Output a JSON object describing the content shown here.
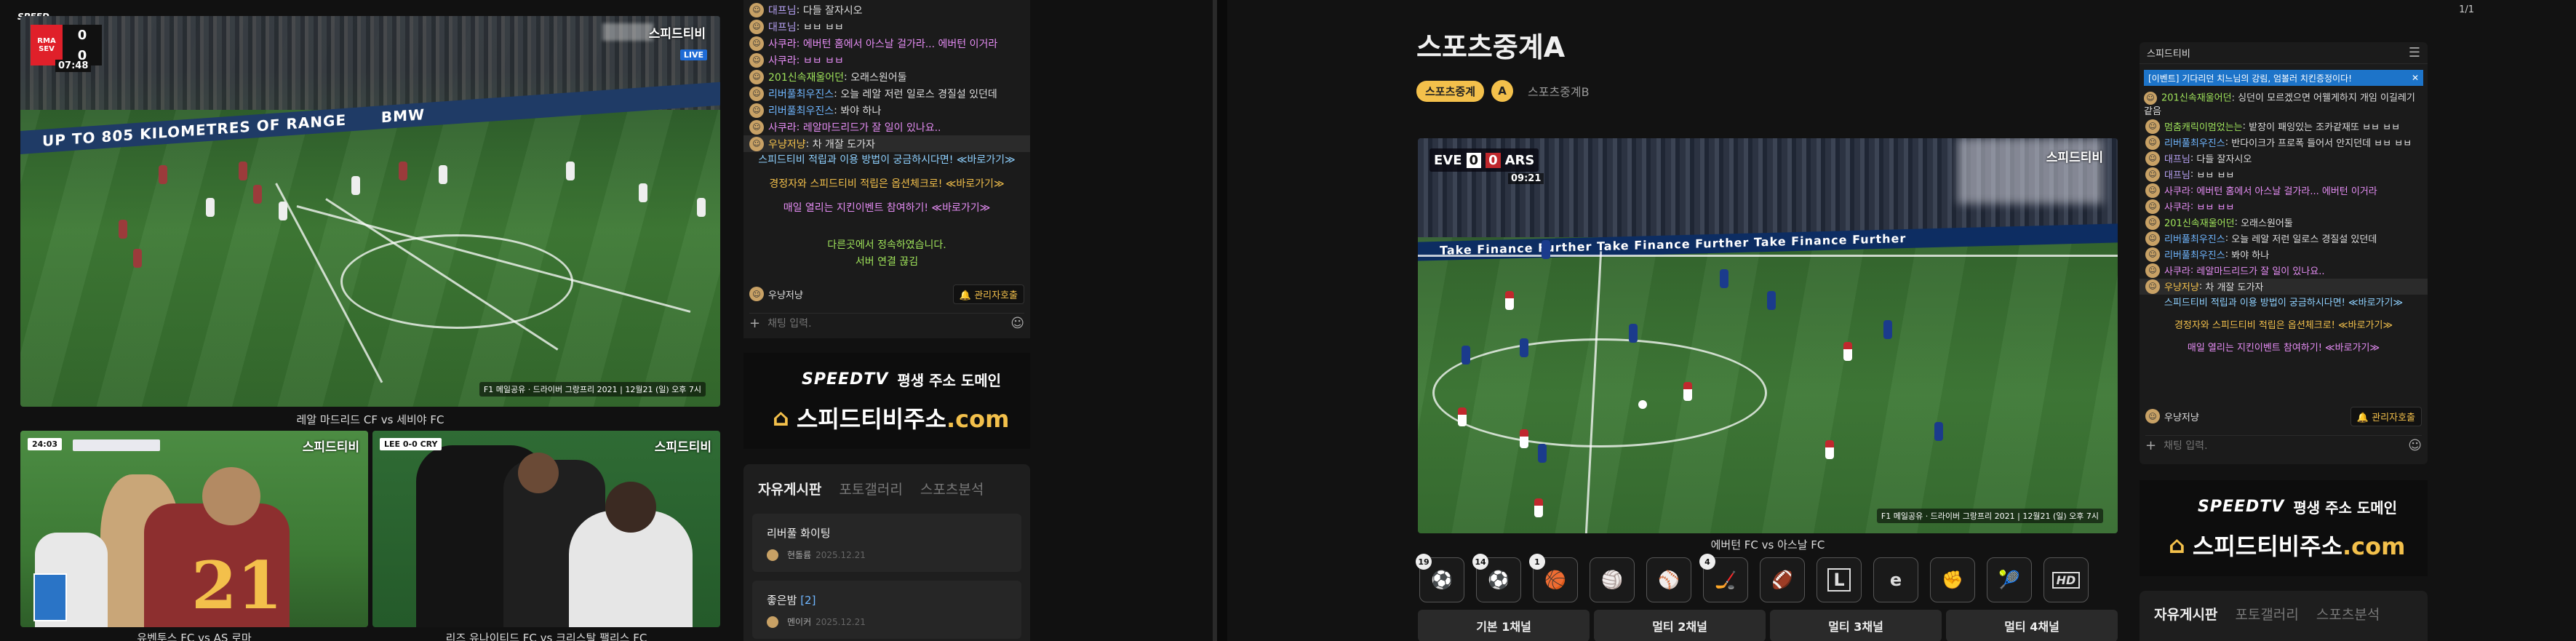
{
  "left_window": {
    "speed_label": "SPEED",
    "main_video": {
      "watermark": "스피드티비",
      "live_badge": "LIVE",
      "score": {
        "home": "0",
        "away": "0",
        "clock": "07:48",
        "home_abbr": "RMA",
        "away_abbr": "SEV"
      },
      "ad_text": "UP TO 805 KILOMETRES OF RANGE",
      "ad_brand": "BMW",
      "ticker": "F1 메일공유 · 드라이버 그랑프리 2021 | 12월21 (일) 오후 7시",
      "caption": "레알 마드리드 CF vs 세비야 FC"
    },
    "video_2": {
      "watermark": "스피드티비",
      "clock": "24:03",
      "caption": "유벤투스 FC vs AS 로마"
    },
    "video_3": {
      "watermark": "스피드티비",
      "clock": "LEE 0-0 CRY",
      "caption": "리즈 유나이티드 FC vs 크리스탈 팰리스 FC"
    },
    "chat": {
      "messages": [
        {
          "user": "대프님",
          "text": "다들 잘자시오",
          "color": "#b7a2f5"
        },
        {
          "user": "대프님",
          "text": "ㅂㅂ ㅂㅂ",
          "color": "#b7a2f5"
        },
        {
          "user": "사쿠라",
          "text": "에버턴 홈에서 아스날 걸가라... 에버턴 이거라",
          "color": "#e68df5"
        },
        {
          "user": "사쿠라",
          "text": "ㅂㅂ ㅂㅂ",
          "color": "#e68df5"
        },
        {
          "user": "201신속재울어던",
          "text": "오래스원어둘",
          "color": "#9fe35a"
        },
        {
          "user": "리버풀최우진스",
          "text": "오늘 레알 저런 일로스 경질설 있던데",
          "color": "#6fb6ff"
        },
        {
          "user": "리버풀최우진스",
          "text": "봐야 하나",
          "color": "#6fb6ff"
        },
        {
          "user": "사쿠라",
          "text": "레알마드리드가 잘 일이 있나요..",
          "color": "#e68df5"
        },
        {
          "user": "우냥저냥",
          "text": "차 개잘 도가자",
          "color": "#f3c04b"
        }
      ],
      "notices": [
        {
          "text": "스피드티비 적립과 이용 방법이 궁금하시다면! ≪바로가기≫",
          "color": "#8fd1ff"
        },
        {
          "text": "경정자와 스피드티비 적립은 옵션체크로! ≪바로가기≫",
          "color": "#f3c04b"
        },
        {
          "text": "매일 열리는 지킨이벤트 참여하기! ≪바로가기≫",
          "color": "#e68df5"
        },
        {
          "text": "다른곳에서 정속하였습니다.",
          "color": "#9fe35a"
        },
        {
          "text": "서버 연결 끊김",
          "color": "#9fe35a"
        }
      ],
      "current_user": "우냥저냥",
      "admin_button": "관리자호출",
      "input_placeholder": "채팅 입력."
    },
    "banner": {
      "logo": "SPEEDTV",
      "slogan": "평생 주소 도메인",
      "domain": "스피드티비주소",
      "tld": ".com"
    },
    "board": {
      "tabs": [
        "자유게시판",
        "포토갤러리",
        "스포츠분석"
      ],
      "posts": [
        {
          "title": "리버풀 화이팅",
          "author": "현돌륨",
          "date": "2025.12.21"
        },
        {
          "title": "좋은밤",
          "count": "[2]",
          "author": "멘이커",
          "date": "2025.12.21"
        }
      ]
    }
  },
  "right_window": {
    "page_counter": "1/1",
    "title": "스포츠중계A",
    "breadcrumb": {
      "chip": "스포츠중계",
      "badge": "A",
      "next": "스포츠중계B"
    },
    "video": {
      "watermark": "스피드티비",
      "home": "EVE",
      "away": "ARS",
      "score_home": "0",
      "score_away": "0",
      "clock": "09:21",
      "ad_text": "Take Finance Further  Take Finance Further  Take Finance Further",
      "ticker": "F1 메일공유 · 드라이버 그랑프리 2021 | 12월21 (일) 오후 7시",
      "caption": "에버턴 FC vs 아스날 FC"
    },
    "sport_icons": [
      {
        "name": "soccer-ball-all-icon",
        "glyph": "⚽",
        "count": "19"
      },
      {
        "name": "soccer-icon",
        "glyph": "⚽",
        "count": "14"
      },
      {
        "name": "basketball-icon",
        "glyph": "🏀",
        "count": "1"
      },
      {
        "name": "volleyball-icon",
        "glyph": "🏐",
        "count": ""
      },
      {
        "name": "baseball-icon",
        "glyph": "⚾",
        "count": ""
      },
      {
        "name": "hockey-icon",
        "glyph": "🏒",
        "count": "4"
      },
      {
        "name": "football-icon",
        "glyph": "🏈",
        "count": ""
      },
      {
        "name": "league-icon",
        "glyph": "L",
        "count": ""
      },
      {
        "name": "esports-icon",
        "glyph": "e",
        "count": ""
      },
      {
        "name": "fist-icon",
        "glyph": "✊",
        "count": ""
      },
      {
        "name": "tennis-icon",
        "glyph": "🎾",
        "count": ""
      },
      {
        "name": "hd-icon",
        "glyph": "HD",
        "count": ""
      }
    ],
    "channel_buttons": [
      "기본 1채널",
      "멀티 2채널",
      "멀티 3채널",
      "멀티 4채널"
    ],
    "chat": {
      "title": "스피드티비",
      "event_banner": "[이벤트] 기다리던 치느님의 강림, 엄볼러 치킨증정이다!",
      "messages": [
        {
          "user": "201신속재울어던",
          "text": "싱던이 모르겠으면 어웰게하지 개임 이길레기 같음",
          "color": "#9fe35a"
        },
        {
          "user": "멈춤캐릭이멈었는는",
          "text": "밭장이 패잉있는 조카같재또 ㅂㅂ ㅂㅂ",
          "color": "#9fe35a"
        },
        {
          "user": "리버풀최우진스",
          "text": "반다이크가 프로폭 들어서 안지던데 ㅂㅂ ㅂㅂ",
          "color": "#6fb6ff"
        },
        {
          "user": "대프님",
          "text": "다들 잘자시오",
          "color": "#b7a2f5"
        },
        {
          "user": "대프님",
          "text": "ㅂㅂ ㅂㅂ",
          "color": "#b7a2f5"
        },
        {
          "user": "사쿠라",
          "text": "에버턴 홈에서 아스날 걸가라... 에버턴 이거라",
          "color": "#e68df5"
        },
        {
          "user": "사쿠라",
          "text": "ㅂㅂ ㅂㅂ",
          "color": "#e68df5"
        },
        {
          "user": "201신속재울어던",
          "text": "오래스원어둘",
          "color": "#9fe35a"
        },
        {
          "user": "리버풀최우진스",
          "text": "오늘 레알 저런 일로스 경질설 있던데",
          "color": "#6fb6ff"
        },
        {
          "user": "리버풀최우진스",
          "text": "봐야 하나",
          "color": "#6fb6ff"
        },
        {
          "user": "사쿠라",
          "text": "레알마드리드가 잘 일이 있나요..",
          "color": "#e68df5"
        },
        {
          "user": "우냥저냥",
          "text": "차 개잘 도가자",
          "color": "#f3c04b"
        }
      ],
      "notices": [
        {
          "text": "스피드티비 적립과 이용 방법이 궁금하시다면! ≪바로가기≫",
          "color": "#8fd1ff"
        },
        {
          "text": "경정자와 스피드티비 적립은 옵션체크로! ≪바로가기≫",
          "color": "#f3c04b"
        },
        {
          "text": "매일 열리는 지킨이벤트 참여하기! ≪바로가기≫",
          "color": "#e68df5"
        }
      ],
      "current_user": "우냥저냥",
      "admin_button": "관리자호출",
      "input_placeholder": "채팅 입력."
    },
    "banner": {
      "logo": "SPEEDTV",
      "slogan": "평생 주소 도메인",
      "domain": "스피드티비주소",
      "tld": ".com"
    },
    "board_tabs": [
      "자유게시판",
      "포토갤러리",
      "스포츠분석"
    ]
  }
}
